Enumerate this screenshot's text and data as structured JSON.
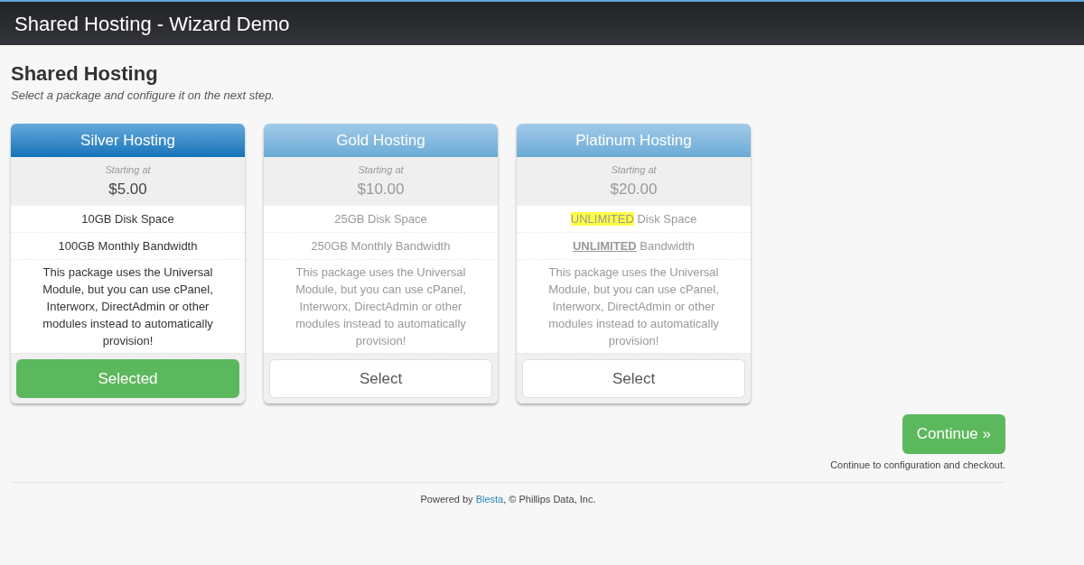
{
  "header": {
    "title": "Shared Hosting - Wizard Demo"
  },
  "page": {
    "heading": "Shared Hosting",
    "subtitle": "Select a package and configure it on the next step."
  },
  "packages": [
    {
      "name": "Silver Hosting",
      "starting_label": "Starting at",
      "price": "$5.00",
      "selected": true,
      "features": [
        {
          "kind": "plain",
          "text": "10GB Disk Space"
        },
        {
          "kind": "plain",
          "text": "100GB Monthly Bandwidth"
        }
      ],
      "description": "This package uses the Universal Module, but you can use cPanel, Interworx, DirectAdmin or other modules instead to automatically provision!",
      "button": "Selected"
    },
    {
      "name": "Gold Hosting",
      "starting_label": "Starting at",
      "price": "$10.00",
      "selected": false,
      "features": [
        {
          "kind": "plain",
          "text": "25GB Disk Space"
        },
        {
          "kind": "plain",
          "text": "250GB Monthly Bandwidth"
        }
      ],
      "description": "This package uses the Universal Module, but you can use cPanel, Interworx, DirectAdmin or other modules instead to automatically provision!",
      "button": "Select"
    },
    {
      "name": "Platinum Hosting",
      "starting_label": "Starting at",
      "price": "$20.00",
      "selected": false,
      "features": [
        {
          "kind": "highlight",
          "emphasis": "UNLIMITED",
          "text": "Disk Space"
        },
        {
          "kind": "underline",
          "emphasis": "UNLIMITED",
          "text": "Bandwidth"
        }
      ],
      "description": "This package uses the Universal Module, but you can use cPanel, Interworx, DirectAdmin or other modules instead to automatically provision!",
      "button": "Select"
    }
  ],
  "continue": {
    "button": "Continue »",
    "hint": "Continue to configuration and checkout."
  },
  "footer": {
    "prefix": "Powered by",
    "link": "Blesta",
    "suffix": ", © Phillips Data, Inc."
  }
}
